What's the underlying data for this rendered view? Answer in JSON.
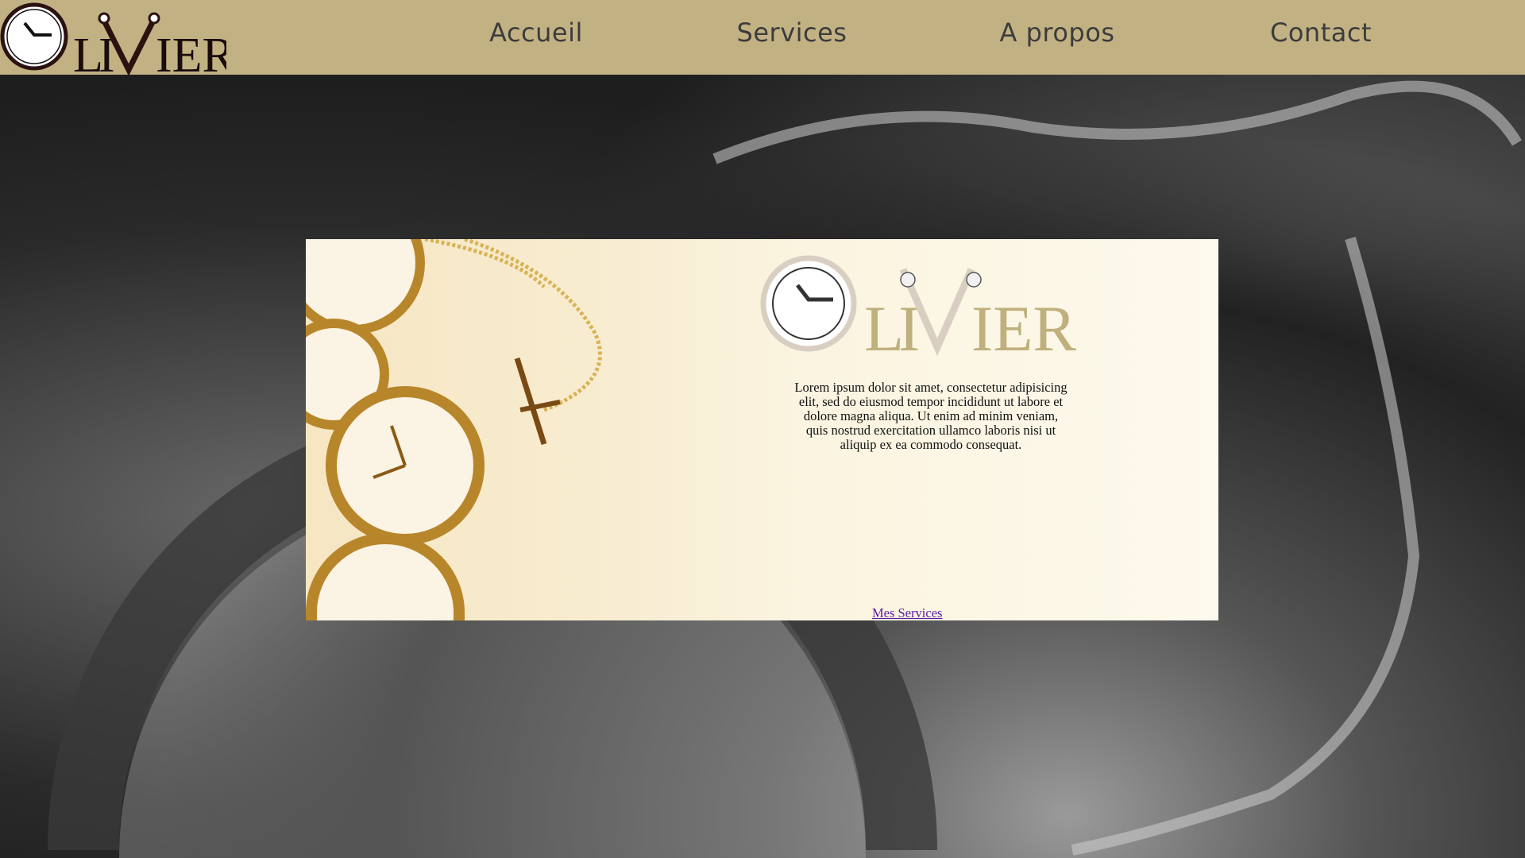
{
  "header": {
    "logo_text": "OLIVIER",
    "nav": [
      {
        "label": "Accueil"
      },
      {
        "label": "Services"
      },
      {
        "label": "A propos"
      },
      {
        "label": "Contact"
      }
    ]
  },
  "panel": {
    "logo_text": "OLIVIER",
    "body": "Lorem ipsum dolor sit amet, consectetur adipisicing elit, sed do eiusmod tempor incididunt ut labore et dolore magna aliqua. Ut enim ad minim veniam, quis nostrud exercitation ullamco laboris nisi ut aliquip ex ea commodo consequat.",
    "link": "Mes Services"
  },
  "colors": {
    "header_bg": "#c2b283",
    "logo_gold": "#bfb07e",
    "link": "#5a1aa0"
  }
}
